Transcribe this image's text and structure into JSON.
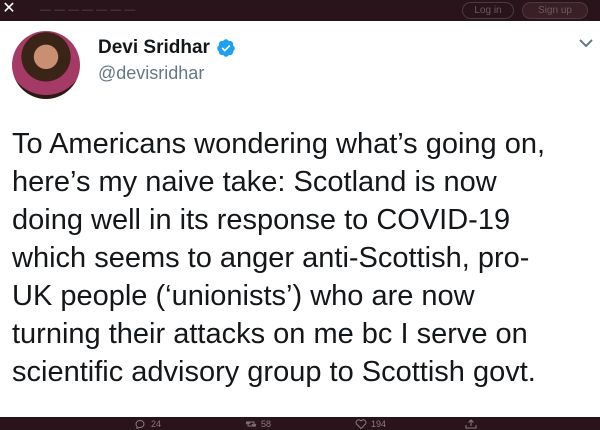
{
  "topbar": {
    "close_glyph": "✕",
    "faint_text": "— — — — — — —",
    "btn_login": "Log in",
    "btn_signup": "Sign up"
  },
  "tweet": {
    "author_name": "Devi Sridhar",
    "handle": "@devisridhar",
    "verified": true,
    "lines": [
      "To Americans wondering what’s going on,",
      "here’s my naive take: Scotland is now",
      "doing well in its response to COVID-19",
      "which seems to anger anti-Scottish, pro-",
      "UK people (‘unionists’) who are now",
      "turning their attacks on me bc I serve on",
      "scientific advisory group to Scottish govt."
    ]
  },
  "actions": {
    "reply_count": "24",
    "retweet_count": "58",
    "like_count": "194"
  },
  "colors": {
    "verified_blue": "#1da1f2",
    "text_primary": "#14171a",
    "text_secondary": "#657786",
    "frame": "#2a141b"
  }
}
